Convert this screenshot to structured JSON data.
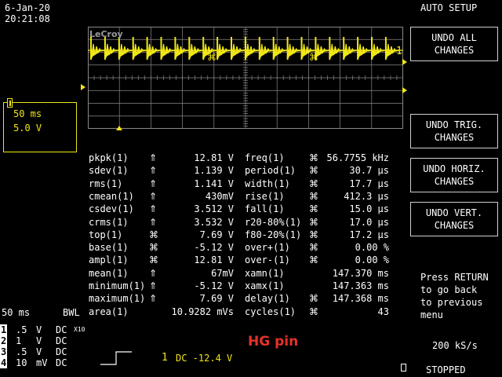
{
  "header": {
    "date": "6-Jan-20",
    "time": "20:21:08",
    "menu_title": "AUTO SETUP"
  },
  "menu": {
    "undo_all": [
      "UNDO ALL",
      "CHANGES"
    ],
    "undo_trig": [
      "UNDO TRIG.",
      "CHANGES"
    ],
    "undo_horiz": [
      "UNDO HORIZ.",
      "CHANGES"
    ],
    "undo_vert": [
      "UNDO VERT.",
      "CHANGES"
    ],
    "help": [
      "Press RETURN",
      "to go back",
      "to previous",
      "menu"
    ]
  },
  "grid": {
    "brand": "LeCroy",
    "channel_marker": "1"
  },
  "trace_box": {
    "timebase": "50 ms",
    "volts": "5.0 V"
  },
  "measurements": {
    "left": [
      {
        "name": "pkpk(1)",
        "sym": "⇑",
        "value": "12.81 V"
      },
      {
        "name": "sdev(1)",
        "sym": "⇑",
        "value": "1.139 V"
      },
      {
        "name": "rms(1)",
        "sym": "⇑",
        "value": "1.141 V"
      },
      {
        "name": "cmean(1)",
        "sym": "⇑",
        "value": "430mV"
      },
      {
        "name": "csdev(1)",
        "sym": "⇑",
        "value": "3.512 V"
      },
      {
        "name": "crms(1)",
        "sym": "⇑",
        "value": "3.532 V"
      },
      {
        "name": "top(1)",
        "sym": "⌘",
        "value": "7.69 V"
      },
      {
        "name": "base(1)",
        "sym": "⌘",
        "value": "-5.12 V"
      },
      {
        "name": "ampl(1)",
        "sym": "⌘",
        "value": "12.81 V"
      },
      {
        "name": "mean(1)",
        "sym": "⇑",
        "value": "67mV"
      },
      {
        "name": "minimum(1)",
        "sym": "⇑",
        "value": "-5.12 V"
      },
      {
        "name": "maximum(1)",
        "sym": "⇑",
        "value": "7.69 V"
      },
      {
        "name": "area(1)",
        "sym": "",
        "value": "10.9282 mVs"
      }
    ],
    "right": [
      {
        "name": "freq(1)",
        "sym": "⌘",
        "value": "56.7755 kHz"
      },
      {
        "name": "period(1)",
        "sym": "⌘",
        "value": "30.7 μs"
      },
      {
        "name": "width(1)",
        "sym": "⌘",
        "value": "17.7 μs"
      },
      {
        "name": "rise(1)",
        "sym": "⌘",
        "value": "412.3 μs"
      },
      {
        "name": "fall(1)",
        "sym": "⌘",
        "value": "15.0 μs"
      },
      {
        "name": "r20-80%(1)",
        "sym": "⌘",
        "value": "17.0 μs"
      },
      {
        "name": "f80-20%(1)",
        "sym": "⌘",
        "value": "17.2 μs"
      },
      {
        "name": "over+(1)",
        "sym": "⌘",
        "value": "0.00 %"
      },
      {
        "name": "over-(1)",
        "sym": "⌘",
        "value": "0.00 %"
      },
      {
        "name": "xamn(1)",
        "sym": "",
        "value": "147.370 ms"
      },
      {
        "name": "xamx(1)",
        "sym": "",
        "value": "147.363 ms"
      },
      {
        "name": "delay(1)",
        "sym": "⌘",
        "value": "147.368 ms"
      },
      {
        "name": "cycles(1)",
        "sym": "⌘",
        "value": "43"
      }
    ]
  },
  "bottom": {
    "timebase": "50 ms",
    "bwl": "BWL",
    "channels": [
      {
        "num": "1",
        "scale": ".5",
        "unit": "V",
        "coupling": "DC",
        "extra": "X10"
      },
      {
        "num": "2",
        "scale": "1",
        "unit": "V",
        "coupling": "DC",
        "extra": ""
      },
      {
        "num": "3",
        "scale": ".5",
        "unit": "V",
        "coupling": "DC",
        "extra": ""
      },
      {
        "num": "4",
        "scale": "10",
        "unit": "mV",
        "coupling": "DC",
        "extra": ""
      }
    ],
    "trigger_channel": "1",
    "trigger_text": "DC -12.4 V",
    "annotation": "HG pin",
    "sample_rate": "200 kS/s",
    "status": "STOPPED"
  },
  "colors": {
    "trace": "#f0e614",
    "grid": "#888888",
    "annotation": "#e8302a",
    "background": "#000000"
  }
}
